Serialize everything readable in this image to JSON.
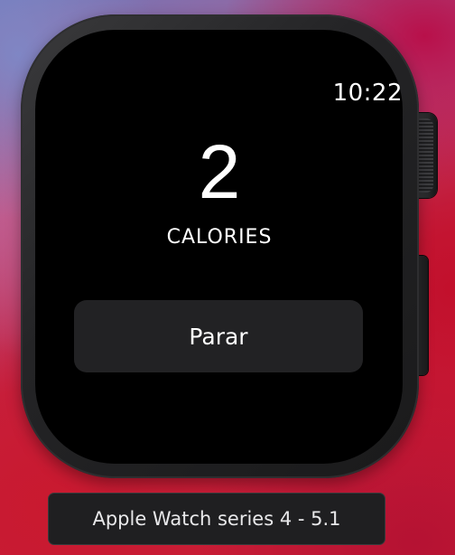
{
  "watch": {
    "time": "10:22",
    "calories_value": "2",
    "calories_label": "CALORIES",
    "stop_button_label": "Parar"
  },
  "device": {
    "label": "Apple Watch series 4 - 5.1"
  },
  "colors": {
    "screen": "#000000",
    "button": "#222224",
    "text": "#ffffff",
    "label_background": "#1f1f21"
  }
}
